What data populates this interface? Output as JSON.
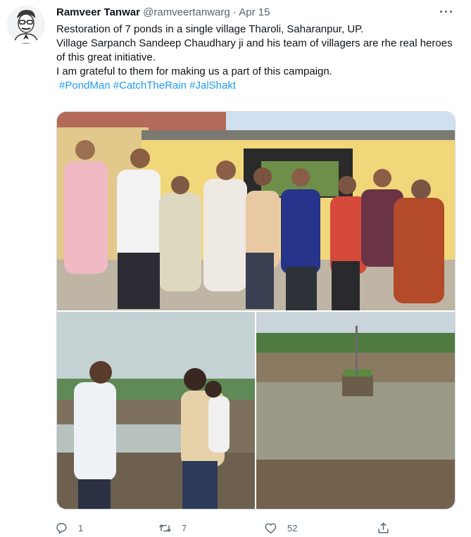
{
  "tweet": {
    "author_name": "Ramveer Tanwar",
    "author_handle": "@ramveertanwarg",
    "separator": "·",
    "date": "Apr 15",
    "text_lines": [
      "Restoration of 7 ponds in a single village Tharoli, Saharanpur, UP.",
      "Village Sarpanch Sandeep Chaudhary ji and his team of villagers are rhe real heroes of this great initiative.",
      "I am grateful to them for making us a part of this campaign."
    ],
    "hashtags": [
      "#PondMan",
      "#CatchTheRain",
      "#JalShakt"
    ]
  },
  "actions": {
    "reply_count": "1",
    "retweet_count": "7",
    "like_count": "52"
  },
  "icons": {
    "more": "more-dots-icon",
    "reply": "reply-icon",
    "retweet": "retweet-icon",
    "like": "heart-icon",
    "share": "share-icon"
  },
  "colors": {
    "text": "#0f1419",
    "secondary": "#536471",
    "link": "#1d9bf0",
    "border": "#cfd9de"
  }
}
